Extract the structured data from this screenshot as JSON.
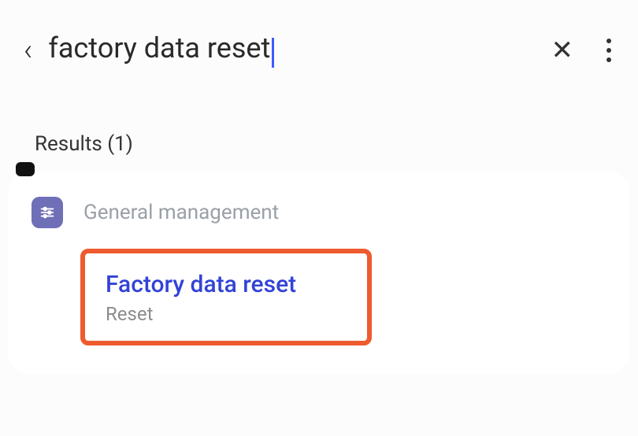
{
  "search": {
    "query": "factory data reset"
  },
  "results_label": "Results (1)",
  "result": {
    "category_label": "General management",
    "title": "Factory data reset",
    "subtitle": "Reset"
  }
}
